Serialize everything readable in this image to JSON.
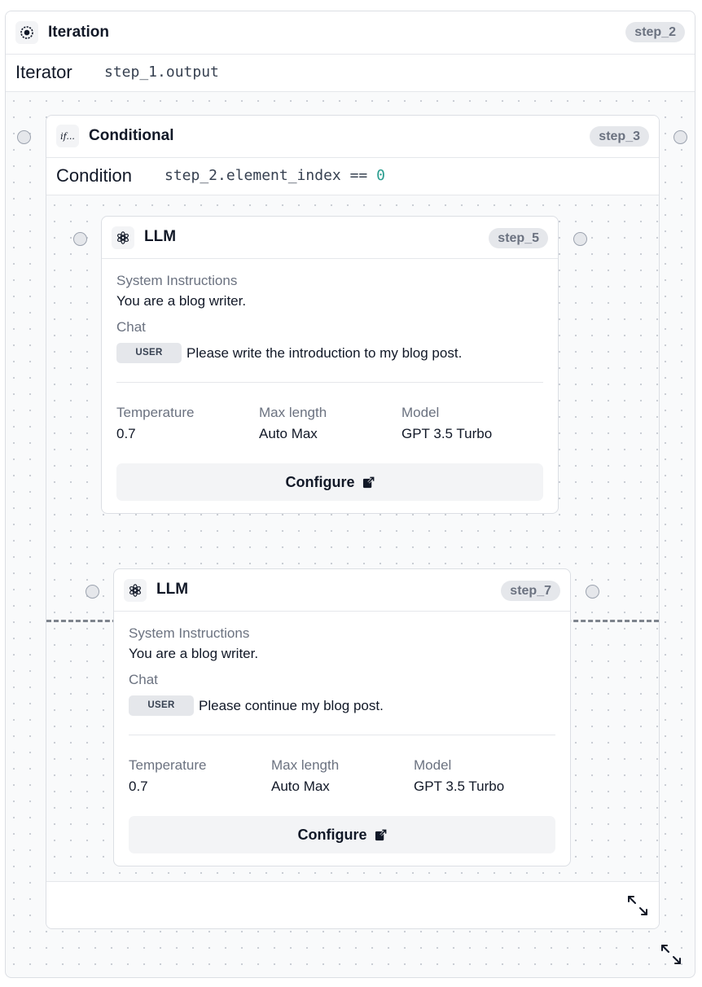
{
  "iteration": {
    "title": "Iteration",
    "step": "step_2",
    "row_label": "Iterator",
    "row_value": "step_1.output",
    "icon": "iteration-icon"
  },
  "conditional": {
    "title": "Conditional",
    "step": "step_3",
    "icon_text": "if...",
    "row_label": "Condition",
    "condition_expr": "step_2.element_index ==",
    "condition_value": "0"
  },
  "llm_nodes": [
    {
      "title": "LLM",
      "step": "step_5",
      "system_label": "System Instructions",
      "system_text": "You are a blog writer.",
      "chat_label": "Chat",
      "role": "USER",
      "message": "Please write the introduction to my blog post.",
      "params": [
        {
          "label": "Temperature",
          "value": "0.7"
        },
        {
          "label": "Max length",
          "value": "Auto Max"
        },
        {
          "label": "Model",
          "value": "GPT 3.5 Turbo"
        }
      ],
      "configure_label": "Configure"
    },
    {
      "title": "LLM",
      "step": "step_7",
      "system_label": "System Instructions",
      "system_text": "You are a blog writer.",
      "chat_label": "Chat",
      "role": "USER",
      "message": "Please continue my blog post.",
      "params": [
        {
          "label": "Temperature",
          "value": "0.7"
        },
        {
          "label": "Max length",
          "value": "Auto Max"
        },
        {
          "label": "Model",
          "value": "GPT 3.5 Turbo"
        }
      ],
      "configure_label": "Configure"
    }
  ],
  "icons": {
    "llm": "openai-logo-icon",
    "configure": "external-link-icon",
    "expand": "expand-icon"
  }
}
